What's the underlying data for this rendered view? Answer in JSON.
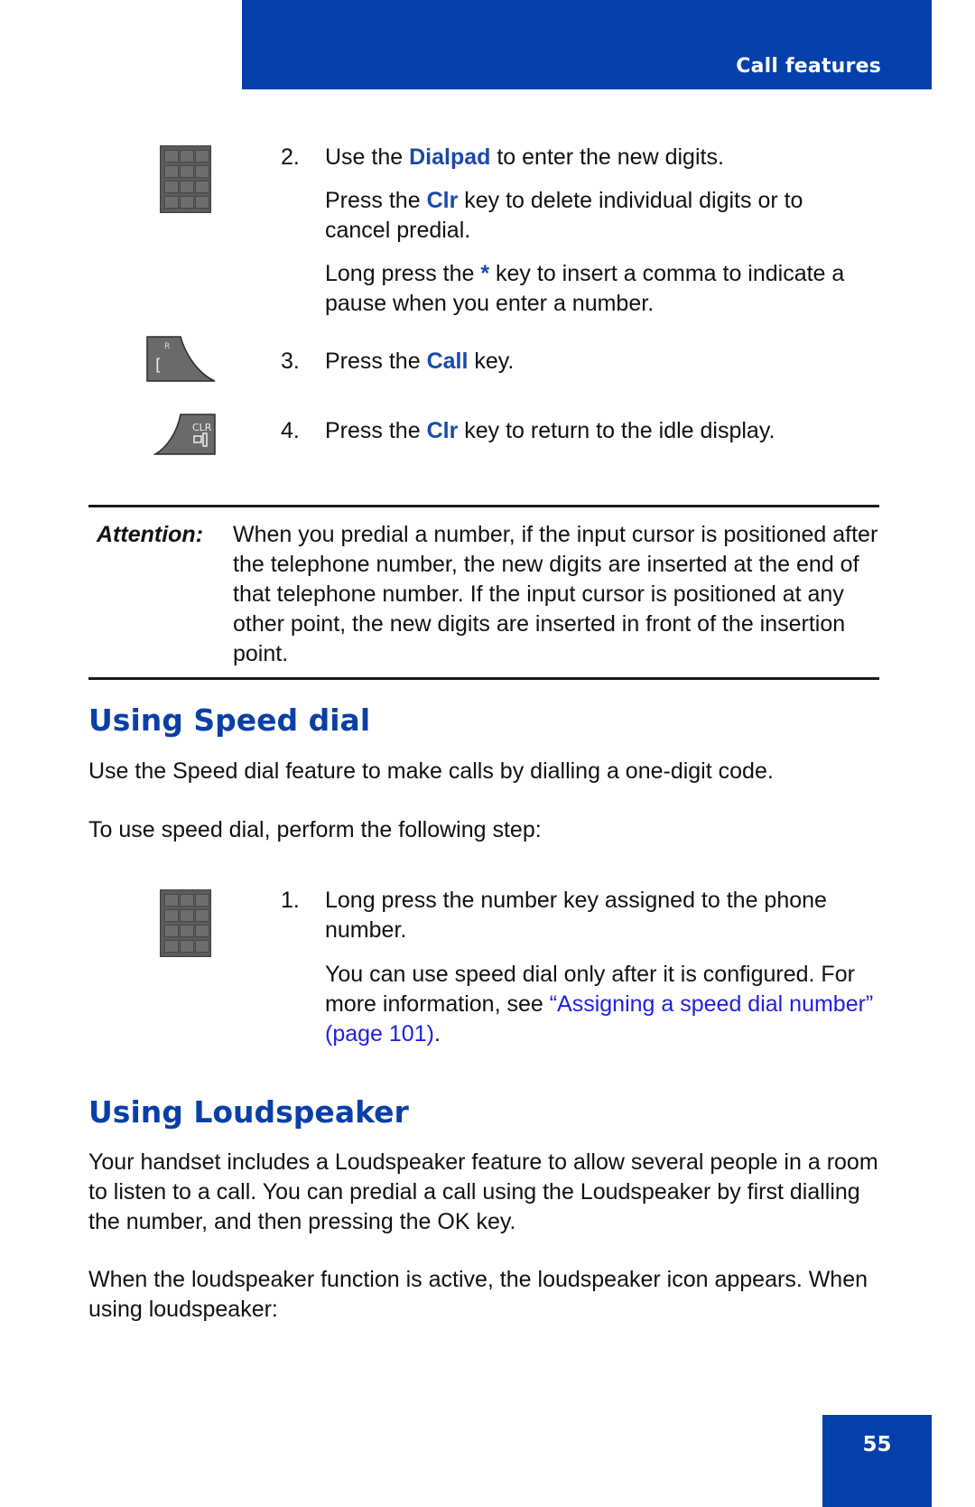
{
  "header": {
    "section_title": "Call features"
  },
  "steps_top": [
    {
      "number": "2.",
      "icon": "dialpad-icon",
      "lines": [
        {
          "parts": [
            {
              "t": "Use the "
            },
            {
              "t": "Dialpad",
              "hl": true
            },
            {
              "t": " to enter the new digits."
            }
          ]
        },
        {
          "parts": [
            {
              "t": "Press the "
            },
            {
              "t": "Clr",
              "hl": true
            },
            {
              "t": " key to delete individual digits or to cancel predial."
            }
          ]
        },
        {
          "parts": [
            {
              "t": "Long press the "
            },
            {
              "t": "*",
              "hl": true
            },
            {
              "t": " key to insert a comma to indicate a pause when you enter a number."
            }
          ]
        }
      ]
    },
    {
      "number": "3.",
      "icon": "call-key-icon",
      "call_key_glyphs": {
        "top": "R",
        "bottom": "["
      },
      "lines": [
        {
          "parts": [
            {
              "t": "Press the "
            },
            {
              "t": "Call",
              "hl": true
            },
            {
              "t": " key."
            }
          ]
        }
      ]
    },
    {
      "number": "4.",
      "icon": "clear-key-icon",
      "clr_key_label": "CLR",
      "lines": [
        {
          "parts": [
            {
              "t": "Press the "
            },
            {
              "t": "Clr",
              "hl": true
            },
            {
              "t": " key to return to the idle display."
            }
          ]
        }
      ]
    }
  ],
  "attention": {
    "label": "Attention:",
    "text": "When you predial a number, if the input cursor is positioned after the telephone number, the new digits are inserted at the end of that telephone number. If the input cursor is positioned at any other point, the new digits are inserted in front of the insertion point."
  },
  "speed_dial": {
    "heading": "Using Speed dial",
    "intro": "Use the Speed dial feature to make calls by dialling a one-digit code.",
    "lead": "To use speed dial, perform the following step:",
    "step": {
      "number": "1.",
      "text": "Long press the number key assigned to the phone number.",
      "note_prefix": "You can use speed dial only after it is configured. For more information, see ",
      "note_link": "“Assigning a speed dial number” (page 101)",
      "note_suffix": "."
    }
  },
  "loudspeaker": {
    "heading": "Using Loudspeaker",
    "para1": "Your handset includes a Loudspeaker feature to allow several people in a room to listen to a call. You can predial a call using the Loudspeaker by first dialling the number, and then pressing the OK key.",
    "para2": "When the loudspeaker function is active, the loudspeaker icon appears. When using loudspeaker:"
  },
  "footer": {
    "page_number": "55"
  },
  "colors": {
    "brand_blue": "#0340ab",
    "highlight_blue": "#1a49a8",
    "link_blue": "#1f1fdd"
  }
}
